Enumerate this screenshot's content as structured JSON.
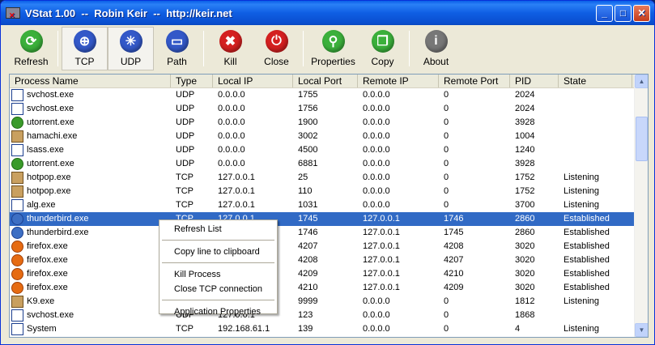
{
  "window": {
    "title": "VStat 1.00  --  Robin Keir  --  http://keir.net"
  },
  "toolbar": [
    {
      "label": "Refresh",
      "icon": "refresh-icon",
      "color": "#3bb03b",
      "glyph": "⟳"
    },
    {
      "label": "TCP",
      "icon": "globe-icon",
      "color": "#3358c8",
      "glyph": "⊕",
      "pressed": true
    },
    {
      "label": "UDP",
      "icon": "burst-icon",
      "color": "#3358c8",
      "glyph": "✳",
      "pressed": true
    },
    {
      "label": "Path",
      "icon": "folder-icon",
      "color": "#3358c8",
      "glyph": "▭"
    },
    {
      "label": "Kill",
      "icon": "x-icon",
      "color": "#d42020",
      "glyph": "✖"
    },
    {
      "label": "Close",
      "icon": "power-icon",
      "color": "#d42020",
      "glyph": "⏻"
    },
    {
      "label": "Properties",
      "icon": "magnifier-icon",
      "color": "#3bb03b",
      "glyph": "⚲"
    },
    {
      "label": "Copy",
      "icon": "copy-icon",
      "color": "#3bb03b",
      "glyph": "❐"
    },
    {
      "label": "About",
      "icon": "info-icon",
      "color": "#777777",
      "glyph": "i"
    }
  ],
  "columns": [
    "Process Name",
    "Type",
    "Local IP",
    "Local Port",
    "Remote IP",
    "Remote Port",
    "PID",
    "State"
  ],
  "rows": [
    {
      "icon": "window",
      "cells": [
        "svchost.exe",
        "UDP",
        "0.0.0.0",
        "1755",
        "0.0.0.0",
        "0",
        "2024",
        ""
      ]
    },
    {
      "icon": "window",
      "cells": [
        "svchost.exe",
        "UDP",
        "0.0.0.0",
        "1756",
        "0.0.0.0",
        "0",
        "2024",
        ""
      ]
    },
    {
      "icon": "green",
      "cells": [
        "utorrent.exe",
        "UDP",
        "0.0.0.0",
        "1900",
        "0.0.0.0",
        "0",
        "3928",
        ""
      ]
    },
    {
      "icon": "brown",
      "cells": [
        "hamachi.exe",
        "UDP",
        "0.0.0.0",
        "3002",
        "0.0.0.0",
        "0",
        "1004",
        ""
      ]
    },
    {
      "icon": "window",
      "cells": [
        "lsass.exe",
        "UDP",
        "0.0.0.0",
        "4500",
        "0.0.0.0",
        "0",
        "1240",
        ""
      ]
    },
    {
      "icon": "green",
      "cells": [
        "utorrent.exe",
        "UDP",
        "0.0.0.0",
        "6881",
        "0.0.0.0",
        "0",
        "3928",
        ""
      ]
    },
    {
      "icon": "brown",
      "cells": [
        "hotpop.exe",
        "TCP",
        "127.0.0.1",
        "25",
        "0.0.0.0",
        "0",
        "1752",
        "Listening"
      ]
    },
    {
      "icon": "brown",
      "cells": [
        "hotpop.exe",
        "TCP",
        "127.0.0.1",
        "110",
        "0.0.0.0",
        "0",
        "1752",
        "Listening"
      ]
    },
    {
      "icon": "window",
      "cells": [
        "alg.exe",
        "TCP",
        "127.0.0.1",
        "1031",
        "0.0.0.0",
        "0",
        "3700",
        "Listening"
      ]
    },
    {
      "icon": "blue",
      "selected": true,
      "cells": [
        "thunderbird.exe",
        "TCP",
        "127.0.0.1",
        "1745",
        "127.0.0.1",
        "1746",
        "2860",
        "Established"
      ]
    },
    {
      "icon": "blue",
      "cells": [
        "thunderbird.exe",
        "",
        "",
        "1746",
        "127.0.0.1",
        "1745",
        "2860",
        "Established"
      ]
    },
    {
      "icon": "orange",
      "cells": [
        "firefox.exe",
        "",
        "",
        "4207",
        "127.0.0.1",
        "4208",
        "3020",
        "Established"
      ]
    },
    {
      "icon": "orange",
      "cells": [
        "firefox.exe",
        "",
        "",
        "4208",
        "127.0.0.1",
        "4207",
        "3020",
        "Established"
      ]
    },
    {
      "icon": "orange",
      "cells": [
        "firefox.exe",
        "",
        "",
        "4209",
        "127.0.0.1",
        "4210",
        "3020",
        "Established"
      ]
    },
    {
      "icon": "orange",
      "cells": [
        "firefox.exe",
        "",
        "",
        "4210",
        "127.0.0.1",
        "4209",
        "3020",
        "Established"
      ]
    },
    {
      "icon": "brown",
      "cells": [
        "K9.exe",
        "",
        "",
        "9999",
        "0.0.0.0",
        "0",
        "1812",
        "Listening"
      ]
    },
    {
      "icon": "window",
      "cells": [
        "svchost.exe",
        "UDP",
        "127.0.0.1",
        "123",
        "0.0.0.0",
        "0",
        "1868",
        ""
      ]
    },
    {
      "icon": "window",
      "cells": [
        "System",
        "TCP",
        "192.168.61.1",
        "139",
        "0.0.0.0",
        "0",
        "4",
        "Listening"
      ]
    }
  ],
  "context_menu": [
    [
      "Refresh List"
    ],
    [
      "Copy line to clipboard"
    ],
    [
      "Kill Process",
      "Close TCP connection"
    ],
    [
      "Application Properties"
    ]
  ]
}
